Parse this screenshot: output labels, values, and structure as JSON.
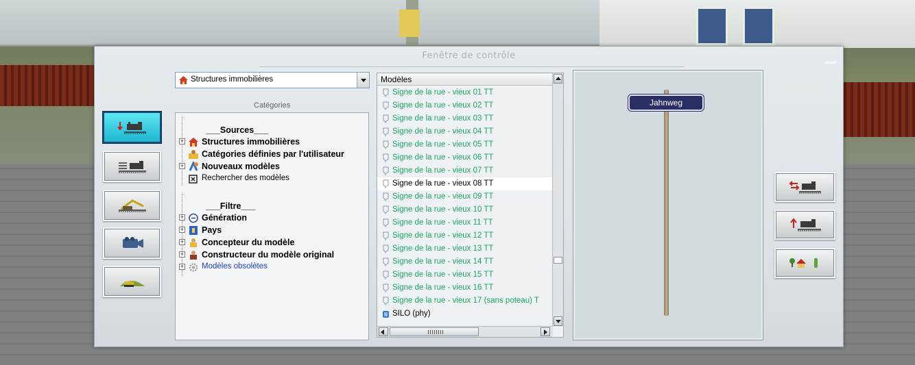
{
  "window": {
    "title": "Fenêtre de contrôle"
  },
  "category_combo": {
    "value": "Structures immobilières"
  },
  "categories_label": "Catégories",
  "tree": {
    "sources_heading": "___Sources___",
    "items_sources": [
      {
        "label": "Structures immobilières",
        "expandable": true
      },
      {
        "label": "Catégories définies par l'utilisateur",
        "expandable": false
      },
      {
        "label": "Nouveaux modèles",
        "expandable": true
      },
      {
        "label": "Rechercher des modèles",
        "expandable": false
      }
    ],
    "filter_heading": "___Filtre___",
    "items_filter": [
      {
        "label": "Génération",
        "expandable": true
      },
      {
        "label": "Pays",
        "expandable": true
      },
      {
        "label": "Concepteur du modèle",
        "expandable": true
      },
      {
        "label": "Constructeur du modèle original",
        "expandable": true
      },
      {
        "label": "Modèles obsolètes",
        "expandable": true
      }
    ]
  },
  "models_list": {
    "header": "Modèles",
    "items": [
      "Signe de la rue - vieux 01 TT",
      "Signe de la rue - vieux 02 TT",
      "Signe de la rue - vieux 03 TT",
      "Signe de la rue - vieux 04 TT",
      "Signe de la rue - vieux 05 TT",
      "Signe de la rue - vieux 06 TT",
      "Signe de la rue - vieux 07 TT",
      "Signe de la rue - vieux 08 TT",
      "Signe de la rue - vieux 09 TT",
      "Signe de la rue - vieux 10 TT",
      "Signe de la rue - vieux 11 TT",
      "Signe de la rue - vieux 12 TT",
      "Signe de la rue - vieux 13 TT",
      "Signe de la rue - vieux 14 TT",
      "Signe de la rue - vieux 15 TT",
      "Signe de la rue - vieux 16 TT",
      "Signe de la rue - vieux 17 (sans poteau) T",
      "SILO (phy)"
    ],
    "selected_index": 7
  },
  "preview": {
    "sign_text": "Jahnweg"
  },
  "colors": {
    "model_item": "#1ea363",
    "active_button": "#1db7cf",
    "obsolete_label": "#1f3fbf"
  }
}
